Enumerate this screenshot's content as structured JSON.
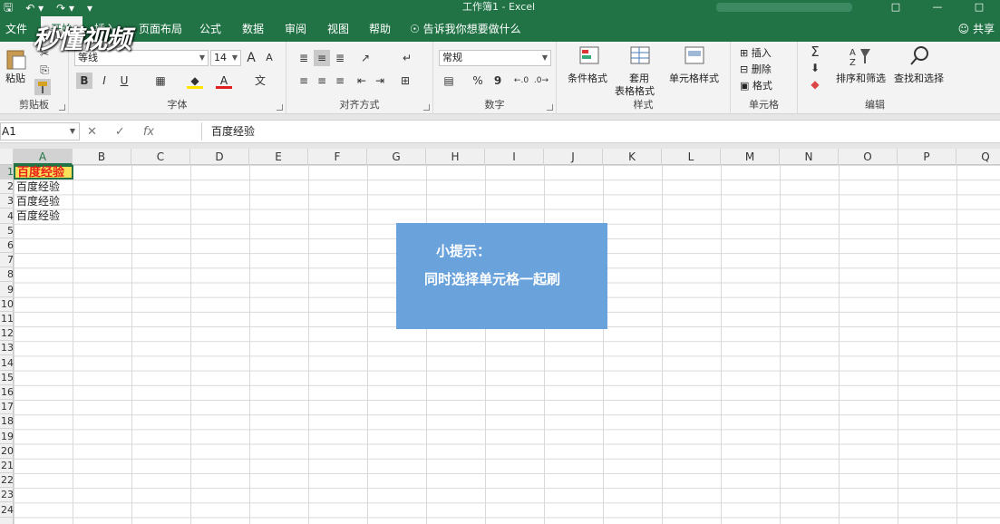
{
  "window": {
    "title": "工作簿1  -  Excel",
    "share": "共享"
  },
  "tabs": [
    {
      "label": "文件"
    },
    {
      "label": "开始"
    },
    {
      "label": "插入"
    },
    {
      "label": "页面布局"
    },
    {
      "label": "公式"
    },
    {
      "label": "数据"
    },
    {
      "label": "审阅"
    },
    {
      "label": "视图"
    },
    {
      "label": "帮助"
    }
  ],
  "tell_me": "告诉我你想要做什么",
  "watermark": "秒懂视频",
  "ribbon": {
    "clipboard": {
      "label": "剪贴板",
      "paste": "粘贴"
    },
    "font": {
      "label": "字体",
      "name": "等线",
      "size": "14",
      "bold": "B",
      "italic": "I",
      "underline": "U",
      "grow": "A",
      "shrink": "A",
      "wen": "文"
    },
    "align": {
      "label": "对齐方式"
    },
    "number": {
      "label": "数字",
      "format": "常规",
      "percent": "%",
      "comma": "9"
    },
    "styles": {
      "label": "样式",
      "conditional": "条件格式",
      "table_1": "套用",
      "table_2": "表格格式",
      "cell_styles": "单元格样式"
    },
    "cells": {
      "label": "单元格",
      "insert": "插入",
      "delete": "删除",
      "format": "格式"
    },
    "editing": {
      "label": "编辑",
      "sort": "排序和筛选",
      "find": "查找和选择"
    }
  },
  "formula_bar": {
    "name_box": "A1",
    "fx": "fx",
    "content": "百度经验"
  },
  "columns": [
    "A",
    "B",
    "C",
    "D",
    "E",
    "F",
    "G",
    "H",
    "I",
    "J",
    "K",
    "L",
    "M",
    "N",
    "O",
    "P",
    "Q"
  ],
  "rows": [
    "1",
    "2",
    "3",
    "4",
    "5",
    "6",
    "7",
    "8",
    "9",
    "10",
    "11",
    "12",
    "13",
    "14",
    "15",
    "16",
    "17",
    "18",
    "19",
    "20",
    "21",
    "22",
    "23",
    "24"
  ],
  "cells": {
    "A1": "百度经验",
    "A2": "百度经验",
    "A3": "百度经验",
    "A4": "百度经验"
  },
  "tip": {
    "title": "小提示：",
    "body": "同时选择单元格一起刷"
  },
  "colors": {
    "excel_green": "#217346",
    "a1_fill": "#fbe15a",
    "a1_text": "#e8201a",
    "tip_bg": "#6aa3dc"
  }
}
